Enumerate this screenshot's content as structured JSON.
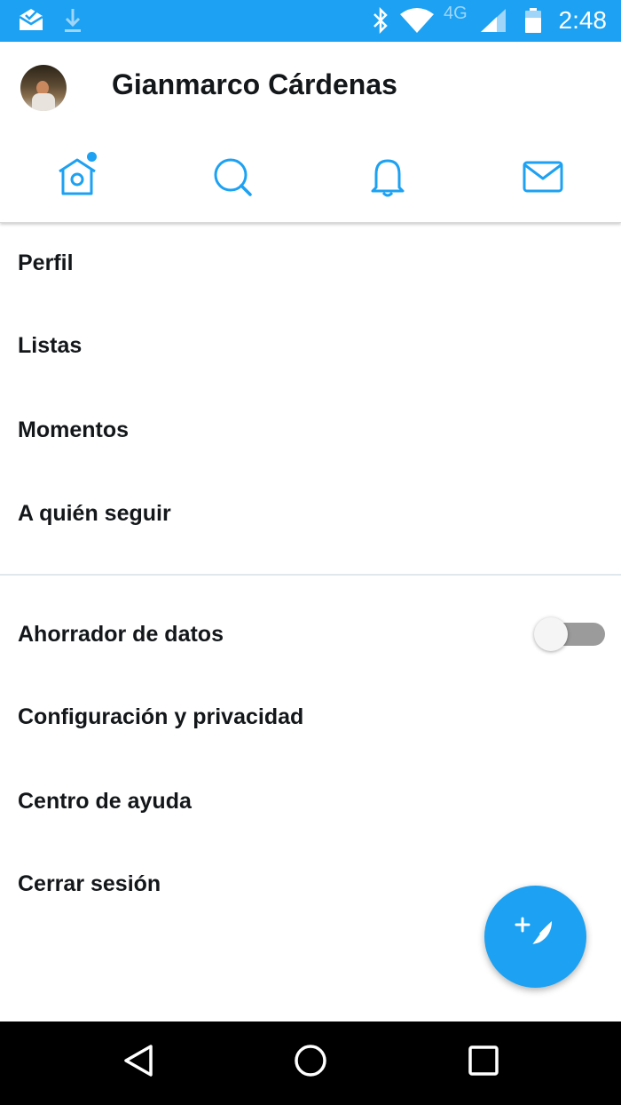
{
  "status_bar": {
    "time": "2:48",
    "network": "4G",
    "icons": [
      "mail-check-icon",
      "download-icon",
      "bluetooth-icon",
      "wifi-icon",
      "signal-icon",
      "battery-icon"
    ]
  },
  "header": {
    "user_name": "Gianmarco Cárdenas",
    "tabs": [
      "home-icon",
      "search-icon",
      "bell-icon",
      "mail-icon"
    ]
  },
  "menu": {
    "items": [
      {
        "label": "Perfil"
      },
      {
        "label": "Listas"
      },
      {
        "label": "Momentos"
      },
      {
        "label": "A quién seguir"
      }
    ],
    "settings": [
      {
        "label": "Ahorrador de datos",
        "toggle": false
      },
      {
        "label": "Configuración y privacidad"
      },
      {
        "label": "Centro de ayuda"
      },
      {
        "label": "Cerrar sesión"
      }
    ]
  },
  "fab": {
    "icon": "compose-tweet-icon"
  },
  "colors": {
    "accent": "#1da1f2",
    "text": "#14171a",
    "navbar": "#000000"
  }
}
